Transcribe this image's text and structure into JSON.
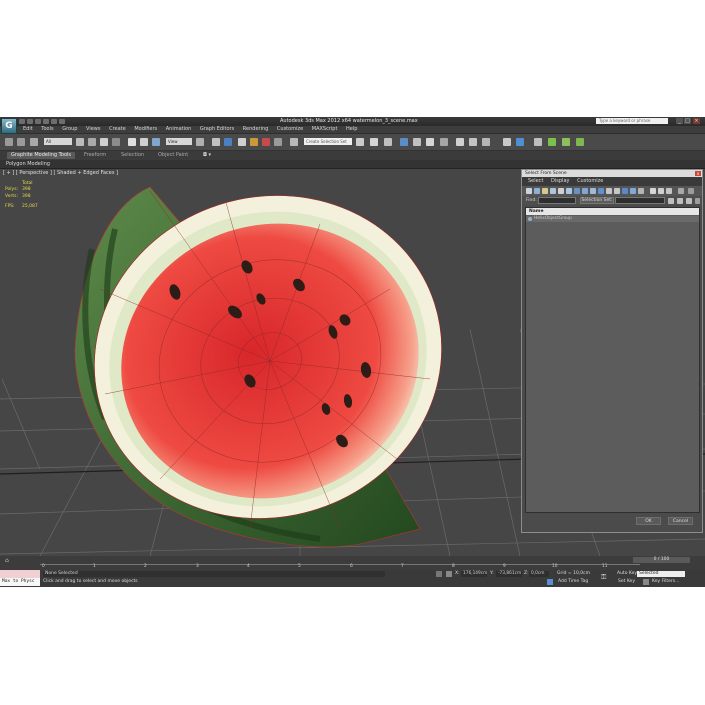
{
  "window": {
    "title": "Autodesk 3ds Max  2012 x64      watermelon_3_scene.max",
    "search_placeholder": "Type a keyword or phrase",
    "controls": {
      "minimize": "_",
      "maximize": "□",
      "close": "×"
    }
  },
  "menu": {
    "items": [
      "Edit",
      "Tools",
      "Group",
      "Views",
      "Create",
      "Modifiers",
      "Animation",
      "Graph Editors",
      "Rendering",
      "Customize",
      "MAXScript",
      "Help"
    ]
  },
  "toolbar": {
    "selection_filter": "All",
    "reference_coord": "View",
    "named_selection_placeholder": "Create Selection Set"
  },
  "ribbon": {
    "tabs": [
      "Graphite Modeling Tools",
      "Freeform",
      "Selection",
      "Object Paint"
    ],
    "sub_label": "Polygon Modeling"
  },
  "viewport": {
    "label": "[ + ] [ Perspective ] [ Shaded + Edged Faces ]",
    "stats": {
      "header": "Total",
      "polys_label": "Polys:",
      "polys_value": "398",
      "verts_label": "Verts:",
      "verts_value": "398",
      "fps_label": "FPS:",
      "fps_value": "25,087"
    }
  },
  "dialog": {
    "title": "Select From Scene",
    "close": "×",
    "menu": [
      "Select",
      "Display",
      "Customize"
    ],
    "find_label": "Find:",
    "selection_set_label": "Selection Set:",
    "list_header": "Name",
    "list_items": [
      "HelixObjectGroup"
    ],
    "ok_label": "OK",
    "cancel_label": "Cancel"
  },
  "timeline": {
    "slider_label": "0 / 100",
    "ticks": [
      "0",
      "1",
      "2",
      "3",
      "4",
      "5",
      "6",
      "7",
      "8",
      "9",
      "10",
      "11"
    ]
  },
  "status": {
    "maxscript_text": "Max to Physc",
    "selection_text": "None Selected",
    "prompt_text": "Click and drag to select and move objects",
    "x_label": "X:",
    "x_value": "176,149cm",
    "y_label": "Y:",
    "y_value": "-73,861cm",
    "z_label": "Z:",
    "z_value": "0,0cm",
    "grid_label": "Grid = 10,0cm",
    "add_time_tag": "Add Time Tag",
    "auto_key": "Auto Key",
    "selected_value": "Selected",
    "set_key": "Set Key",
    "key_filters": "Key Filters..."
  },
  "colors": {
    "app_bg": "#444444",
    "viewport_bg": "#464646",
    "stats_text": "#e8d64a",
    "watermelon_flesh": "#e8463f",
    "watermelon_rind": "#2f5a2c"
  }
}
